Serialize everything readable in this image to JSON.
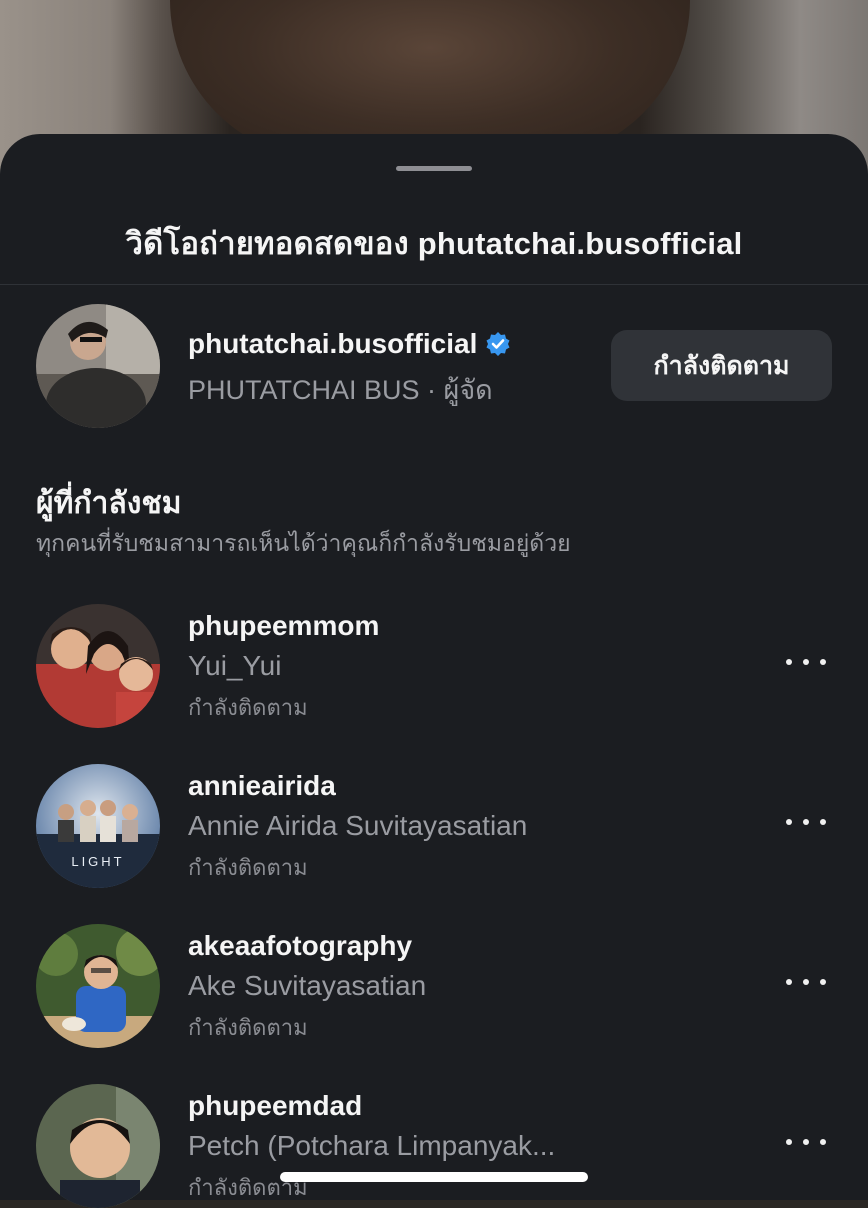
{
  "sheet": {
    "title": "วิดีโอถ่ายทอดสดของ phutatchai.busofficial"
  },
  "host": {
    "username": "phutatchai.busofficial",
    "subtitle": "PHUTATCHAI BUS · ผู้จัด",
    "verified_icon": "verified-badge-icon",
    "follow_button_label": "กำลังติดตาม"
  },
  "viewers_section": {
    "title": "ผู้ที่กำลังชม",
    "description": "ทุกคนที่รับชมสามารถเห็นได้ว่าคุณก็กำลังรับชมอยู่ด้วย"
  },
  "viewers": [
    {
      "username": "phupeemmom",
      "full_name": "Yui_Yui",
      "status": "กำลังติดตาม"
    },
    {
      "username": "annieairida",
      "full_name": "Annie Airida Suvitayasatian",
      "status": "กำลังติดตาม"
    },
    {
      "username": "akeaafotography",
      "full_name": "Ake Suvitayasatian",
      "status": "กำลังติดตาม"
    },
    {
      "username": "phupeemdad",
      "full_name": "Petch (Potchara Limpanyak...",
      "status": "กำลังติดตาม"
    }
  ],
  "colors": {
    "sheet_background": "#1b1d21",
    "button_background": "#303338",
    "verified_blue": "#3897f0",
    "secondary_text": "#9a9ca2"
  }
}
